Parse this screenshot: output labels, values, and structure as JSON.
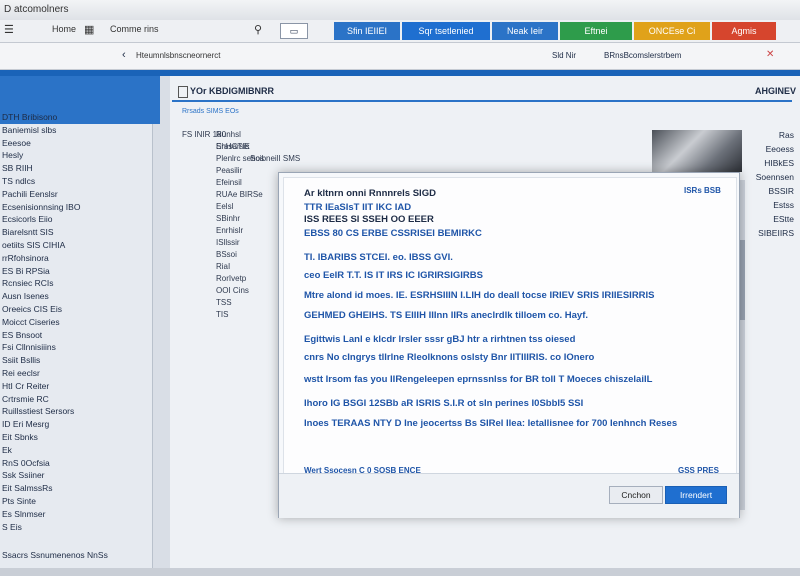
{
  "window": {
    "title": "D atcomolners"
  },
  "toolbar": {
    "home": "Home",
    "comment": "Comme rins"
  },
  "tabs": [
    {
      "label": "Sfin IEIIEI",
      "color": "#2b73c7"
    },
    {
      "label": "Sqr tsetlenied",
      "color": "#1f6fd0"
    },
    {
      "label": "Neak Ieir",
      "color": "#2b73c7"
    },
    {
      "label": "Eftnei",
      "color": "#2e9c4b"
    },
    {
      "label": "ONCEse Ci",
      "color": "#e0a21a"
    },
    {
      "label": "Agmis",
      "color": "#d6452d"
    }
  ],
  "address": {
    "url": "Hteumnlsbnscneornerct",
    "right1": "Sld Nir",
    "right2": "BRnsBcomslerstrbem"
  },
  "main": {
    "title": "YOr KBDIGMIBNRR",
    "right_title": "AHGINEV",
    "subtitle": "Rrsads SIMS EOs"
  },
  "sidebar": {
    "items": [
      "DTH Bribisono",
      "Baniemisl slbs",
      "Eeesoe",
      "Hesly",
      "SB RIIH",
      "TS ndlcs",
      "Pachili Eenslsr",
      "Ecsenisionnsing IBO",
      "Ecsicorls Eiio",
      "Biarelsntt SIS",
      "oetiits SIS CIHIA",
      "rrRfohsinora",
      "ES Bi RPSia",
      "Rcnsiec RCIs",
      "Ausn Isenes",
      "Oreeics CIS Eis",
      "Moicct Ciseries",
      "ES Bnsoot",
      "Fsi Cllnnisiiins",
      "Ssiit Bsllis",
      "Rei eeclsr",
      "HtI Cr Reiter",
      "Crtrsmie RC",
      "Ruillsstiest Sersors",
      "ID Eri Mesrg",
      "Eit Sbnks",
      "Ek",
      "RnS 0Ocfsia",
      "Ssk Ssiiner",
      "Eit SalmssRs",
      "Pts Sinte",
      "Es Slnmser",
      "S Eis"
    ],
    "footer": "Ssacrs Ssnumenenos NnSs"
  },
  "background": {
    "lines": [
      "FS INIR 180",
      "EhHCTIE",
      "SoibneilI SMS",
      "Runhsl",
      "Srasarsis",
      "Plenlrc sehos",
      "Peasilir",
      "Efeinsil",
      "RUAe BIRSe",
      "Eelsl",
      "SBinhr",
      "Enrhislr",
      "ISllssir",
      "BSsoi",
      "RiaI",
      "RorIvetp",
      "OOI Cins",
      "TSS",
      "TIS"
    ],
    "right_col": [
      "Ras",
      "Eeoess",
      "HIBkES",
      "Soennsen",
      "BSSIR",
      "Estss",
      "EStte",
      "SIBEIIRS"
    ]
  },
  "modal": {
    "lines": [
      {
        "text": "Ar kltnrn onni Rnnnrels SIGD",
        "style": "dark"
      },
      {
        "text": "TTR IEaSIsT IIT IKC IAD",
        "style": "blue"
      },
      {
        "text": "ISS REES Sl    SSEH OO EEER",
        "style": "dark"
      },
      {
        "text": "EBSS 80 CS  ERBE  CSSRISEI BEMIRKC",
        "style": "blue"
      },
      {
        "text": "TI. IBARIBS STCEI. eo. IBSS GVI.",
        "style": "blue"
      },
      {
        "text": "ceo EeIR T.T. IS IT IRS  IC IGRIRSIGIRBS",
        "style": "blue"
      },
      {
        "text": "Mtre alond id moes.  IE. ESRHSIIIN I.LIH do deall tocse IRIEV SRIS IRIIESIRRIS",
        "style": "blue"
      },
      {
        "text": "GEHMED GHEIHS. TS EIIIH IIInn IIRs   aneclrdlk tilloem co. Hayf.",
        "style": "blue"
      },
      {
        "text": "Egittwis  Lanl e klcdr lrsler sssr gBJ htr a rirhtnen tss oiesed",
        "style": "blue"
      },
      {
        "text": "cnrs  No cIngrys tllrlne Rleolknons oslsty Bnr IITIIIRIS.  co IOnero",
        "style": "blue"
      },
      {
        "text": "wstt Irsom fas you IIRengeleepen eprnssnlss for BR toIl T Moeces chiszelaiIL",
        "style": "blue"
      },
      {
        "text": "Ihoro IG BSGI   12SBb aR ISRIS S.I.R ot sln perines I0Sbbl5 SSI",
        "style": "blue"
      },
      {
        "text": "Inoes TERAAS NTY  D Ine jeocertss Bs SIRel Ilea: Ietallisnee for 700 Ienhnch Reses",
        "style": "blue"
      }
    ],
    "footer_note": "Wert Ssocesn C 0 SOSB ENCE",
    "footer_right": "GSS PRES",
    "header_right": "ISRs BSB",
    "cancel_label": "Cnchon",
    "primary_label": "Irrendert"
  }
}
